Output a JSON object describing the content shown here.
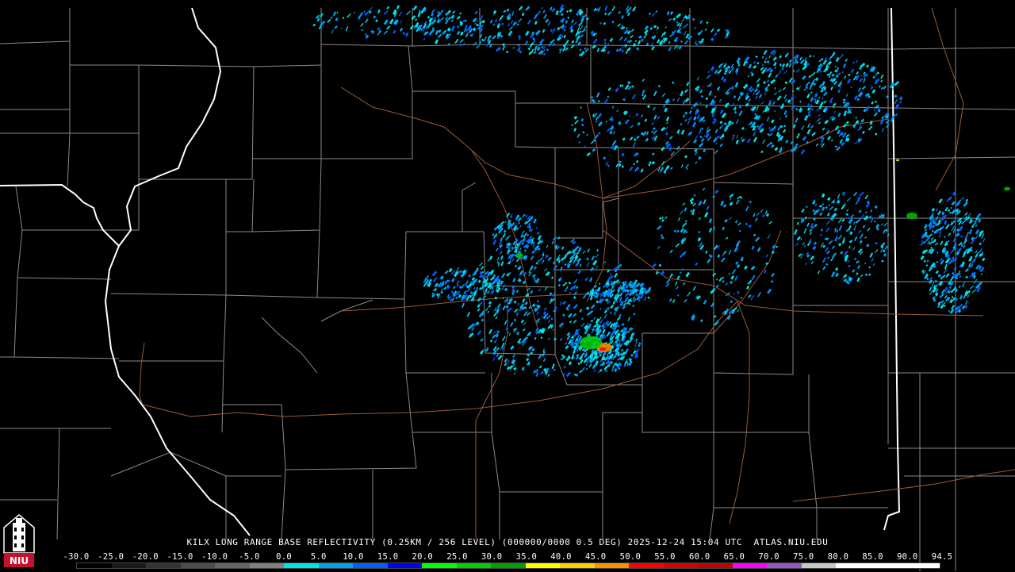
{
  "radar": {
    "caption": "KILX LONG RANGE BASE REFLECTIVITY (0.25KM / 256 LEVEL) (000000/0000 0.5 DEG) 2025-12-24 15:04 UTC  ATLAS.NIU.EDU",
    "scale_labels": [
      "-30.0",
      "-25.0",
      "-20.0",
      "-15.0",
      "-10.0",
      "-5.0",
      "0.0",
      "5.0",
      "10.0",
      "15.0",
      "20.0",
      "25.0",
      "30.0",
      "35.0",
      "40.0",
      "45.0",
      "50.0",
      "55.0",
      "60.0",
      "65.0",
      "70.0",
      "75.0",
      "80.0",
      "85.0",
      "90.0",
      "94.5"
    ],
    "scale_colors": [
      "#000000",
      "#1a1a1a",
      "#333333",
      "#4d4d4d",
      "#666666",
      "#808080",
      "#00e4e4",
      "#00a2f2",
      "#0060ff",
      "#0000f0",
      "#00ff00",
      "#00d000",
      "#00a000",
      "#ffff00",
      "#ffd000",
      "#ff9000",
      "#ff0000",
      "#d60000",
      "#c00000",
      "#ff00ff",
      "#9955c8",
      "#c8c8c8",
      "#ffffff",
      "#ffffff",
      "#ffffff"
    ]
  },
  "logo": {
    "text": "NIU",
    "color": "#c8102e"
  }
}
